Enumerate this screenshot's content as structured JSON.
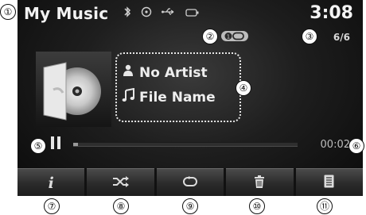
{
  "header": {
    "title": "My Music",
    "clock": "3:08",
    "track_count": "6/6",
    "status_icons": [
      "bluetooth-icon",
      "disc-icon",
      "usb-icon",
      "battery-icon"
    ]
  },
  "now_playing": {
    "artist": "No Artist",
    "file_name": "File Name",
    "elapsed": "00:02",
    "progress": 0.02,
    "repeat_mode": "repeat-one"
  },
  "toolbar": {
    "buttons": [
      {
        "name": "info",
        "glyph": "i"
      },
      {
        "name": "shuffle",
        "glyph": "⤮"
      },
      {
        "name": "repeat",
        "glyph": "⟲"
      },
      {
        "name": "delete",
        "glyph": "🗑"
      },
      {
        "name": "list",
        "glyph": "≣"
      }
    ]
  },
  "callouts": [
    "①",
    "②",
    "③",
    "④",
    "⑤",
    "⑥",
    "⑦",
    "⑧",
    "⑨",
    "⑩",
    "⑪"
  ],
  "colors": {
    "screen_bg": "#1e1e1e",
    "text": "#f2f2f2",
    "button_bg": "#3a3a3a"
  }
}
